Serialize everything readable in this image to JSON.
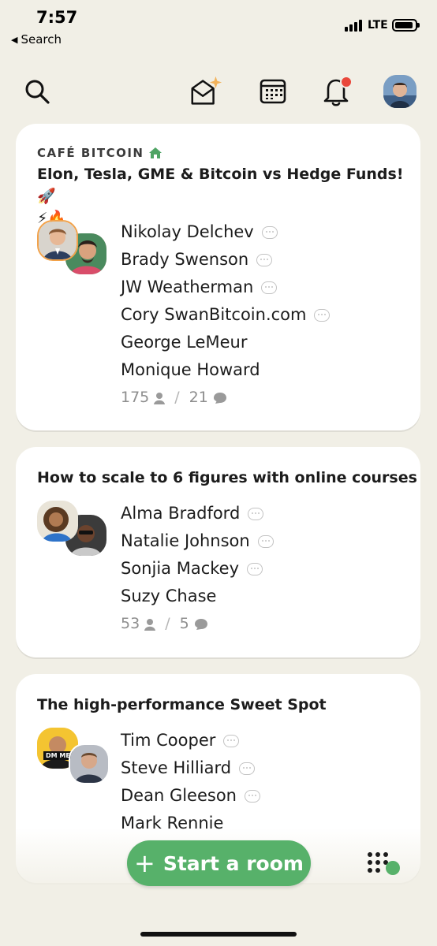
{
  "status_bar": {
    "time": "7:57",
    "back_label": "Search",
    "network": "LTE"
  },
  "nav": {
    "icons": [
      "search-icon",
      "envelope-sparkle-icon",
      "calendar-icon",
      "bell-icon",
      "avatar"
    ],
    "notification_color": "#e9473a"
  },
  "rooms": [
    {
      "club": "CAFÉ BITCOIN",
      "title_line1": "Elon, Tesla, GME & Bitcoin vs Hedge Funds! 🚀",
      "title_line2": "⚡🔥",
      "speakers": [
        "Nikolay Delchev",
        "Brady Swenson",
        "JW Weatherman",
        "Cory SwanBitcoin.com",
        "George LeMeur",
        "Monique Howard"
      ],
      "speaker_bubbles": [
        true,
        true,
        true,
        true,
        false,
        false
      ],
      "listeners": "175",
      "speaking": "21"
    },
    {
      "title": "How to scale to 6 figures with online courses",
      "speakers": [
        "Alma Bradford",
        "Natalie Johnson",
        "Sonjia Mackey",
        "Suzy Chase"
      ],
      "speaker_bubbles": [
        true,
        true,
        true,
        false
      ],
      "listeners": "53",
      "speaking": "5"
    },
    {
      "title": "The high-performance Sweet Spot",
      "speakers": [
        "Tim Cooper",
        "Steve Hilliard",
        "Dean Gleeson",
        "Mark Rennie"
      ],
      "speaker_bubbles": [
        true,
        true,
        true,
        false
      ],
      "avatar_badge": "DM ME"
    }
  ],
  "start_room_label": "Start a room",
  "colors": {
    "accent": "#57b16a",
    "background": "#f1efe6"
  }
}
